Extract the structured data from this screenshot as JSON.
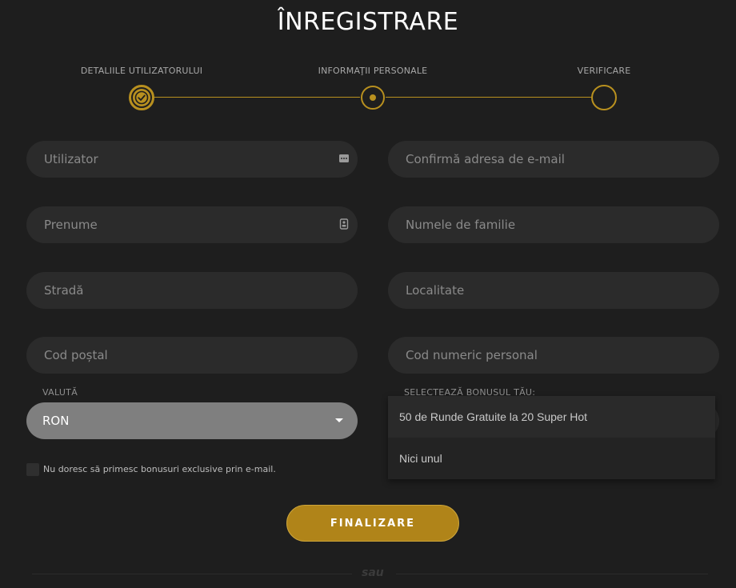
{
  "title": "ÎNREGISTRARE",
  "steps": [
    {
      "label": "DETALIILE UTILIZATORULUI",
      "state": "done"
    },
    {
      "label": "INFORMAŢII PERSONALE",
      "state": "active"
    },
    {
      "label": "VERIFICARE",
      "state": "pending"
    }
  ],
  "fields": {
    "username": {
      "placeholder": "Utilizator",
      "icon": "ellipsis-icon"
    },
    "confirm_email": {
      "placeholder": "Confirmă adresa de e-mail"
    },
    "first_name": {
      "placeholder": "Prenume",
      "icon": "id-card-icon"
    },
    "last_name": {
      "placeholder": "Numele de familie"
    },
    "street": {
      "placeholder": "Stradă"
    },
    "city": {
      "placeholder": "Localitate"
    },
    "postal_code": {
      "placeholder": "Cod poștal"
    },
    "cnp": {
      "placeholder": "Cod numeric personal"
    }
  },
  "currency": {
    "label": "VALUTĂ",
    "selected": "RON"
  },
  "bonus": {
    "label": "SELECTEAZĂ BONUSUL TĂU:",
    "options": [
      "50 de Runde Gratuite la 20 Super Hot",
      "Nici unul"
    ]
  },
  "newsletter_optout": {
    "label": "Nu doresc să primesc bonusuri exclusive prin e-mail.",
    "checked": false
  },
  "submit_label": "FINALIZARE",
  "divider_text": "sau",
  "colors": {
    "background": "#1e1e1e",
    "accent": "#b08419",
    "input_bg": "#2b2b2b"
  }
}
